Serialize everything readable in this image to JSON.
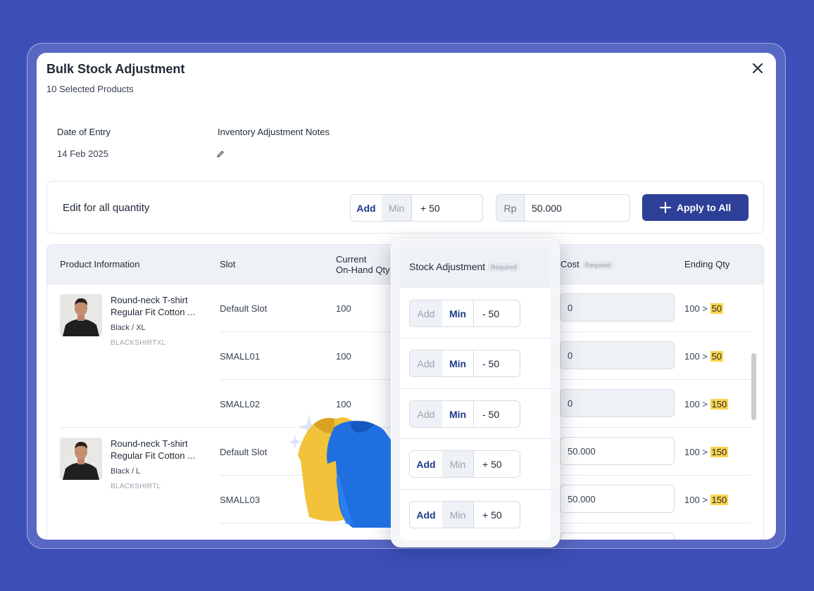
{
  "modal": {
    "title": "Bulk Stock Adjustment",
    "subtitle": "10 Selected Products",
    "date_label": "Date of Entry",
    "date_value": "14 Feb 2025",
    "notes_label": "Inventory Adjustment Notes"
  },
  "edit_all": {
    "label": "Edit for all quantity",
    "add_label": "Add",
    "min_label": "Min",
    "selected": "Add",
    "qty": "+ 50",
    "currency": "Rp",
    "amount": "50.000",
    "apply_label": "Apply to All"
  },
  "table": {
    "headers": {
      "product": "Product Information",
      "slot": "Slot",
      "current_1": "Current",
      "current_2": "On-Hand Qty",
      "cost": "Cost",
      "cost_req": "Required",
      "ending": "Ending Qty"
    },
    "products": [
      {
        "name_1": "Round-neck T-shirt",
        "name_2": "Regular Fit Cotton ...",
        "variant": "Black / XL",
        "sku": "BLACKSHIRTXL"
      },
      {
        "name_1": "Round-neck T-shirt",
        "name_2": "Regular Fit Cotton ...",
        "variant": "Black / L",
        "sku": "BLACKSHIRTL"
      }
    ],
    "rows": [
      {
        "slot": "Default Slot",
        "current": "100",
        "cost": "0",
        "ending_from": "100 >",
        "ending_to": "50"
      },
      {
        "slot": "SMALL01",
        "current": "100",
        "cost": "0",
        "ending_from": "100 >",
        "ending_to": "50"
      },
      {
        "slot": "SMALL02",
        "current": "100",
        "cost": "0",
        "ending_from": "100 >",
        "ending_to": "150"
      },
      {
        "slot": "Default Slot",
        "current": "",
        "cost": "50.000",
        "ending_from": "100 >",
        "ending_to": "150"
      },
      {
        "slot": "SMALL03",
        "current": "",
        "cost": "50.000",
        "ending_from": "100 >",
        "ending_to": "150"
      }
    ]
  },
  "stock_adjustment": {
    "title": "Stock Adjustment",
    "required": "Required",
    "add_label": "Add",
    "min_label": "Min",
    "rows": [
      {
        "selected": "Min",
        "qty": "- 50"
      },
      {
        "selected": "Min",
        "qty": "- 50"
      },
      {
        "selected": "Min",
        "qty": "- 50"
      },
      {
        "selected": "Add",
        "qty": "+ 50"
      },
      {
        "selected": "Add",
        "qty": "+ 50"
      }
    ]
  },
  "colors": {
    "background": "#3c4fb8",
    "primary_button": "#2e3f98",
    "highlight": "#fcd34d",
    "accent_text": "#1e3a8a"
  },
  "icons": [
    "close-icon",
    "pencil-icon",
    "plus-icon",
    "sparkle-icon",
    "tshirt-illustration"
  ]
}
